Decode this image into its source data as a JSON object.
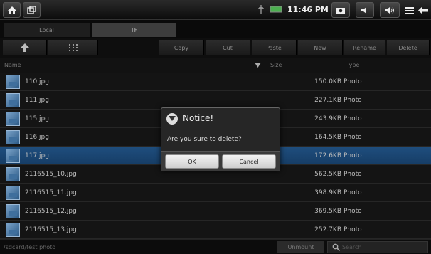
{
  "statusbar": {
    "time": "11:46 PM",
    "icons": [
      "home-icon",
      "window-icon",
      "usb-icon",
      "battery-icon",
      "camera-icon",
      "volume-down-icon",
      "volume-up-icon",
      "menu-icon",
      "back-icon"
    ]
  },
  "tabs": {
    "local": "Local",
    "tf": "TF"
  },
  "toolbar": {
    "copy": "Copy",
    "cut": "Cut",
    "paste": "Paste",
    "new": "New",
    "rename": "Rename",
    "delete": "Delete"
  },
  "header": {
    "name": "Name",
    "size": "Size",
    "type": "Type"
  },
  "files": [
    {
      "name": "110.jpg",
      "size": "150.0KB",
      "type": "Photo"
    },
    {
      "name": "111.jpg",
      "size": "227.1KB",
      "type": "Photo"
    },
    {
      "name": "115.jpg",
      "size": "243.9KB",
      "type": "Photo"
    },
    {
      "name": "116.jpg",
      "size": "164.5KB",
      "type": "Photo"
    },
    {
      "name": "117.jpg",
      "size": "172.6KB",
      "type": "Photo"
    },
    {
      "name": "2116515_10.jpg",
      "size": "562.5KB",
      "type": "Photo"
    },
    {
      "name": "2116515_11.jpg",
      "size": "398.9KB",
      "type": "Photo"
    },
    {
      "name": "2116515_12.jpg",
      "size": "369.5KB",
      "type": "Photo"
    },
    {
      "name": "2116515_13.jpg",
      "size": "252.7KB",
      "type": "Photo"
    }
  ],
  "bottom": {
    "path": "/sdcard/test photo",
    "unmount": "Unmount",
    "search_placeholder": "Search"
  },
  "dialog": {
    "title": "Notice!",
    "message": "Are you sure to delete?",
    "ok": "OK",
    "cancel": "Cancel"
  },
  "colors": {
    "selection": "#1f4e7e",
    "background": "#141414"
  }
}
